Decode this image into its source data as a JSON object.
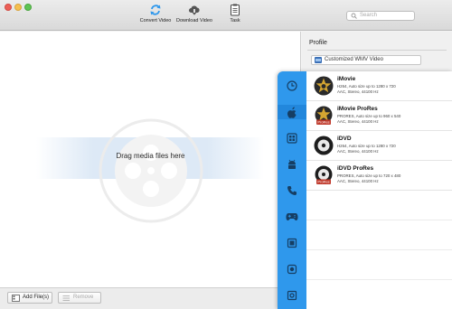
{
  "toolbar": {
    "convert_label": "Convert Video",
    "download_label": "Download Video",
    "task_label": "Task",
    "search_placeholder": "Search"
  },
  "main": {
    "drop_text": "Drag media files here"
  },
  "bottom": {
    "add_label": "Add File(s)",
    "remove_label": "Remove"
  },
  "profile": {
    "title": "Profile",
    "selected": "Customized WMV Video"
  },
  "categories": [
    {
      "icon": "clock-icon"
    },
    {
      "icon": "apple-icon"
    },
    {
      "icon": "windows-icon"
    },
    {
      "icon": "android-icon"
    },
    {
      "icon": "phone-icon"
    },
    {
      "icon": "gamepad-icon"
    },
    {
      "icon": "tv-icon"
    },
    {
      "icon": "device-icon"
    },
    {
      "icon": "device-2-icon"
    }
  ],
  "presets": [
    {
      "name": "iMovie",
      "line1": "H264, Auto size up to 1280 x 720",
      "line2": "AAC, Stereo, 44100 Hz",
      "icon": "imovie-icon"
    },
    {
      "name": "iMovie ProRes",
      "line1": "PRORES, Auto size up to 960 x 540",
      "line2": "AAC, Stereo, 44100 Hz",
      "icon": "imovie-prores-icon"
    },
    {
      "name": "iDVD",
      "line1": "H264, Auto size up to 1280 x 720",
      "line2": "AAC, Stereo, 44100 Hz",
      "icon": "idvd-icon"
    },
    {
      "name": "iDVD ProRes",
      "line1": "PRORES, Auto size up to 720 x 480",
      "line2": "AAC, Stereo, 44100 Hz",
      "icon": "idvd-prores-icon"
    }
  ],
  "colors": {
    "accent": "#2f98ec",
    "accent_selected": "#2287dc"
  }
}
